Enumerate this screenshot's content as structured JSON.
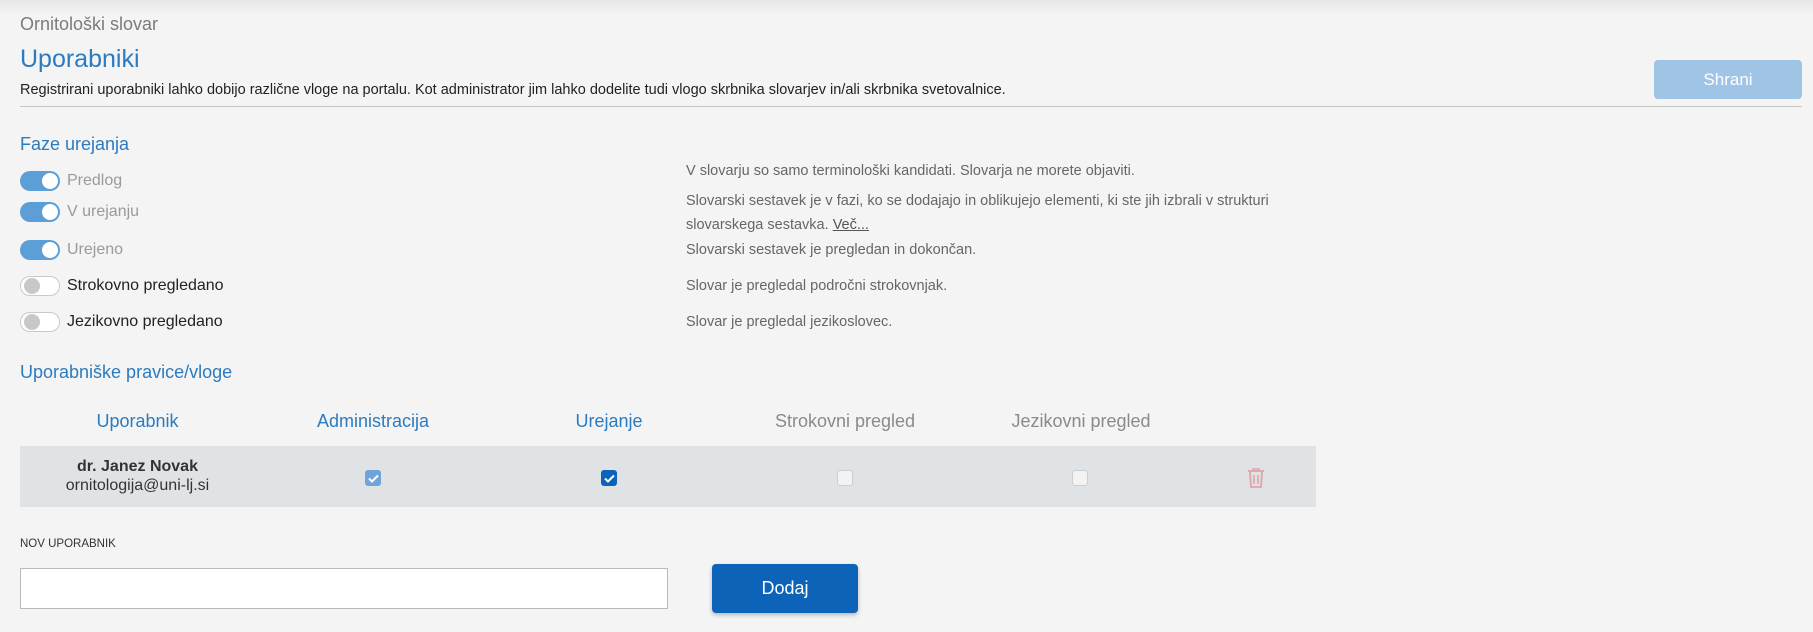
{
  "breadcrumb": "Ornitološki slovar",
  "page_title": "Uporabniki",
  "description": "Registrirani uporabniki lahko dobijo različne vloge na portalu. Kot administrator jim lahko dodelite tudi vlogo skrbnika slovarjev in/ali skrbnika svetovalnice.",
  "save_label": "Shrani",
  "phases_section": {
    "title": "Faze urejanja",
    "items": [
      {
        "label": "Predlog",
        "on": true,
        "description": "V slovarju so samo terminološki kandidati. Slovarja ne morete objaviti."
      },
      {
        "label": "V urejanju",
        "on": true,
        "description": "Slovarski sestavek je v fazi, ko se dodajajo in oblikujejo elementi, ki ste jih izbrali v strukturi slovarskega sestavka.",
        "more_link": "Več..."
      },
      {
        "label": "Urejeno",
        "on": true,
        "description": "Slovarski sestavek je pregledan in dokončan."
      },
      {
        "label": "Strokovno pregledano",
        "on": false,
        "description": "Slovar je pregledal področni strokovnjak."
      },
      {
        "label": "Jezikovno pregledano",
        "on": false,
        "description": "Slovar je pregledal jezikoslovec."
      }
    ]
  },
  "roles_section": {
    "title": "Uporabniške pravice/vloge",
    "columns": [
      "Uporabnik",
      "Administracija",
      "Urejanje",
      "Strokovni pregled",
      "Jezikovni pregled"
    ],
    "rows": [
      {
        "name": "dr. Janez Novak",
        "email": "ornitologija@uni-lj.si",
        "administracija": true,
        "urejanje": true,
        "strokovni_pregled": false,
        "jezikovni_pregled": false
      }
    ]
  },
  "new_user": {
    "label": "NOV UPORABNIK",
    "value": "",
    "add_label": "Dodaj"
  },
  "colors": {
    "accent": "#2c7bbf",
    "primary_button": "#0d63b8",
    "disabled_button": "#9fc4e6",
    "toggle_on": "#5c9fd6"
  },
  "icons": {
    "checkbox_checked": "check-icon",
    "delete": "trash-icon"
  }
}
